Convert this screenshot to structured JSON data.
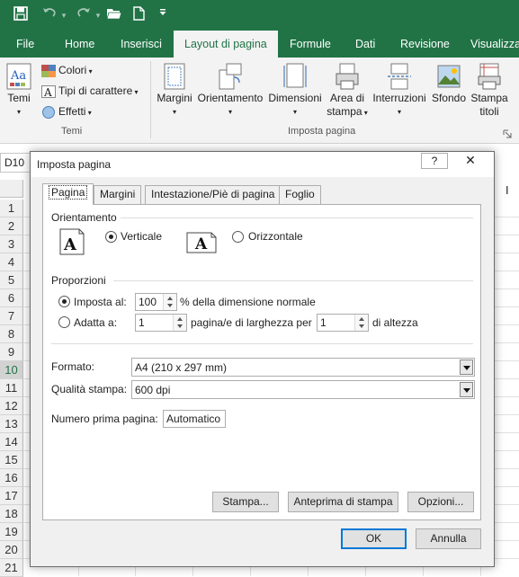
{
  "qat": {
    "save_icon": "save-icon",
    "undo_icon": "undo-icon",
    "redo_icon": "redo-icon",
    "open_icon": "folder-open-icon",
    "new_icon": "new-document-icon",
    "more_icon": "customize-qat-icon"
  },
  "ribbon_tabs": [
    "File",
    "Home",
    "Inserisci",
    "Layout di pagina",
    "Formule",
    "Dati",
    "Revisione",
    "Visualizza"
  ],
  "ribbon": {
    "temi": {
      "temi_label": "Temi",
      "colori": "Colori",
      "tipi": "Tipi di carattere",
      "effetti": "Effetti",
      "group": "Temi"
    },
    "imposta": {
      "margini": "Margini",
      "orientamento": "Orientamento",
      "dimensioni": "Dimensioni",
      "area_1": "Area di",
      "area_2": "stampa",
      "interruzioni": "Interruzioni",
      "sfondo": "Sfondo",
      "stampa_1": "Stampa",
      "stampa_2": "titoli",
      "group": "Imposta pagina"
    }
  },
  "namebox": "D10",
  "col_marker": "I",
  "rows": [
    "1",
    "2",
    "3",
    "4",
    "5",
    "6",
    "7",
    "8",
    "9",
    "10",
    "11",
    "12",
    "13",
    "14",
    "15",
    "16",
    "17",
    "18",
    "19",
    "20",
    "21"
  ],
  "selected_row": "10",
  "dialog": {
    "title": "Imposta pagina",
    "help": "?",
    "close": "✕",
    "tabs": [
      "Pagina",
      "Margini",
      "Intestazione/Piè di pagina",
      "Foglio"
    ],
    "orientamento": {
      "label": "Orientamento",
      "icon_letter": "A",
      "verticale": "Verticale",
      "orizzontale": "Orizzontale",
      "selected": "verticale"
    },
    "proporzioni": {
      "label": "Proporzioni",
      "imposta_al": "Imposta al:",
      "imposta_value": "100",
      "imposta_suffix": "% della dimensione normale",
      "adatta_a": "Adatta a:",
      "adatta_width_value": "1",
      "adatta_middle": "pagina/e di larghezza per",
      "adatta_height_value": "1",
      "adatta_suffix": "di altezza",
      "selected": "imposta"
    },
    "formato_label": "Formato:",
    "formato_value": "A4 (210 x 297 mm)",
    "qualita_label": "Qualità stampa:",
    "qualita_value": "600 dpi",
    "numero_label": "Numero prima pagina:",
    "numero_value": "Automatico",
    "buttons": {
      "stampa": "Stampa...",
      "anteprima": "Anteprima di stampa",
      "opzioni": "Opzioni...",
      "ok": "OK",
      "annulla": "Annulla"
    }
  }
}
